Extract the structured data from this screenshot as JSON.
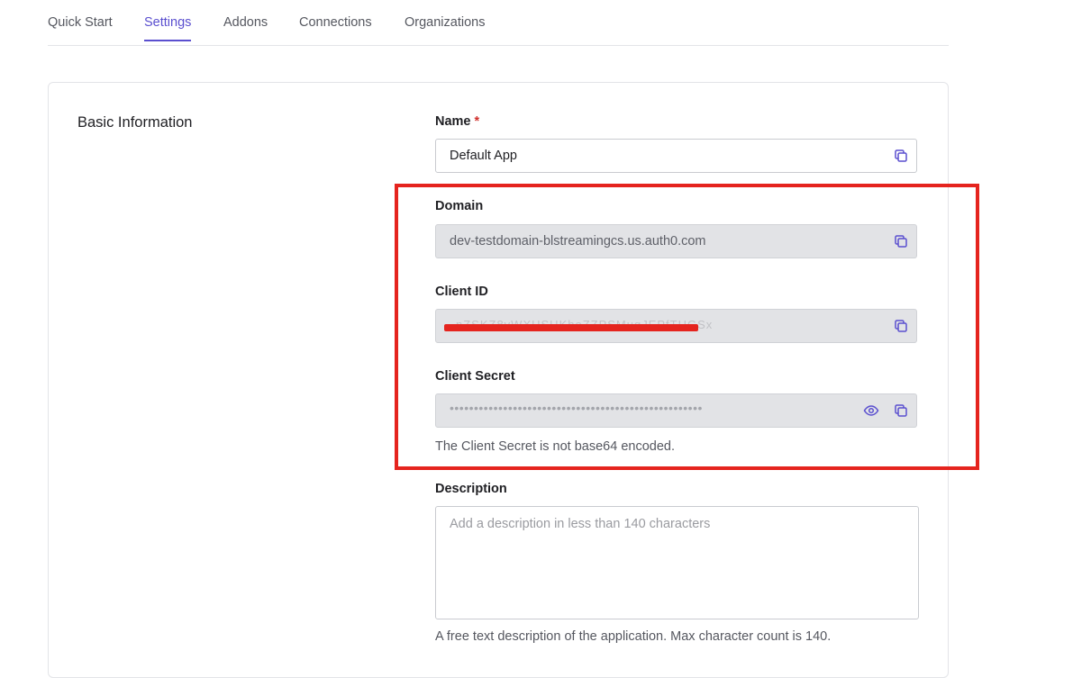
{
  "tabs": [
    {
      "label": "Quick Start",
      "active": false
    },
    {
      "label": "Settings",
      "active": true
    },
    {
      "label": "Addons",
      "active": false
    },
    {
      "label": "Connections",
      "active": false
    },
    {
      "label": "Organizations",
      "active": false
    }
  ],
  "basic_info": {
    "title": "Basic Information",
    "name": {
      "label": "Name",
      "required_mark": "*",
      "value": "Default App"
    },
    "domain": {
      "label": "Domain",
      "value": "dev-testdomain-blstreamingcs.us.auth0.com"
    },
    "client_id": {
      "label": "Client ID",
      "value": "nZSKZ8vWXUSUKhoZZPSMuqJEPfTHGSx"
    },
    "client_secret": {
      "label": "Client Secret",
      "masked_value": "••••••••••••••••••••••••••••••••••••••••••••••••••••",
      "help": "The Client Secret is not base64 encoded."
    },
    "description": {
      "label": "Description",
      "placeholder": "Add a description in less than 140 characters",
      "help": "A free text description of the application. Max character count is 140."
    }
  },
  "colors": {
    "accent": "#5a4fcf",
    "highlight": "#e5241e",
    "readonly_bg": "#e2e3e6"
  },
  "icons": {
    "copy": "copy-icon",
    "reveal": "eye-icon"
  }
}
